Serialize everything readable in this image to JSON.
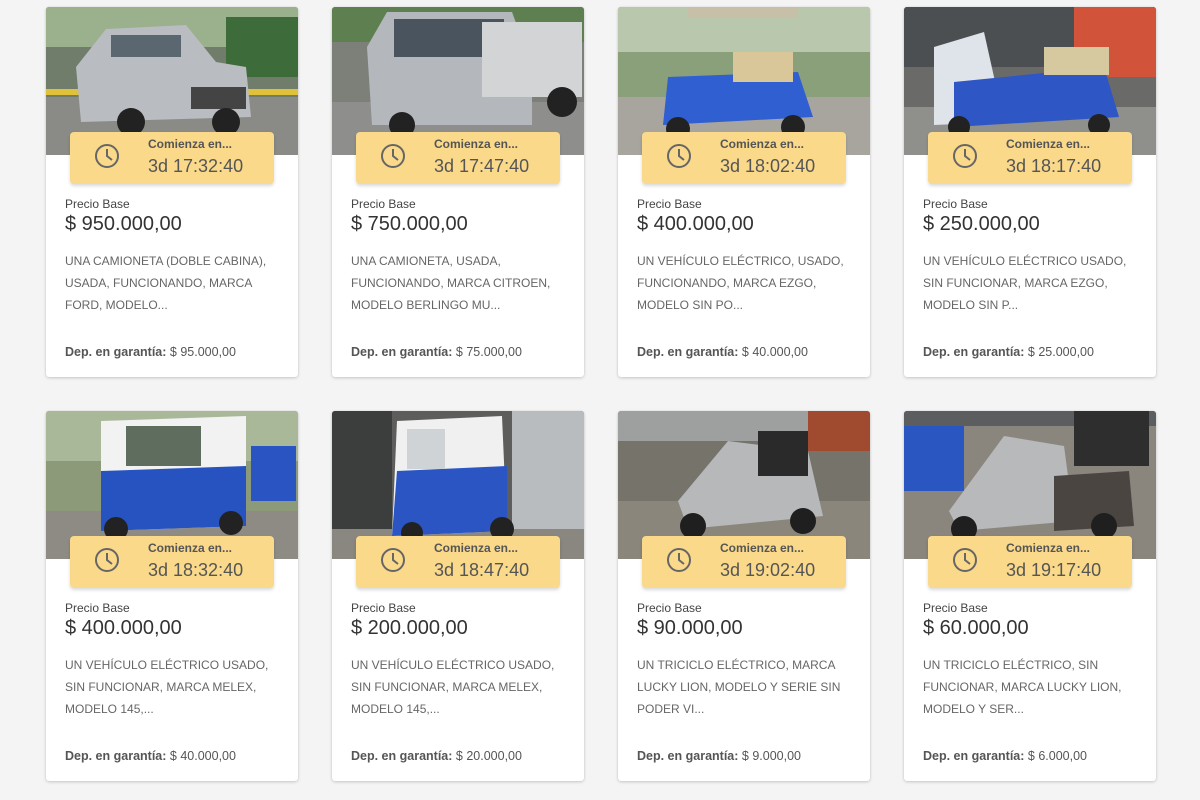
{
  "badge_label": "Comienza en...",
  "price_label": "Precio Base",
  "deposit_label": "Dep. en garantía:",
  "accent_color": "#fad98a",
  "lots": [
    {
      "photo": "silver-pickup-truck",
      "countdown": "3d 17:32:40",
      "price": "$ 950.000,00",
      "description": "UNA CAMIONETA (DOBLE CABINA), USADA, FUNCIONANDO, MARCA FORD, MODELO...",
      "deposit": "$ 95.000,00"
    },
    {
      "photo": "silver-van",
      "countdown": "3d 17:47:40",
      "price": "$ 750.000,00",
      "description": "UNA CAMIONETA, USADA, FUNCIONANDO, MARCA CITROEN, MODELO BERLINGO MU...",
      "deposit": "$ 75.000,00"
    },
    {
      "photo": "blue-golf-cart",
      "countdown": "3d 18:02:40",
      "price": "$ 400.000,00",
      "description": "UN VEHÍCULO ELÉCTRICO, USADO, FUNCIONANDO, MARCA EZGO, MODELO SIN PO...",
      "deposit": "$ 40.000,00"
    },
    {
      "photo": "blue-golf-cart-indoor",
      "countdown": "3d 18:17:40",
      "price": "$ 250.000,00",
      "description": "UN VEHÍCULO ELÉCTRICO USADO, SIN FUNCIONAR, MARCA EZGO, MODELO SIN P...",
      "deposit": "$ 25.000,00"
    },
    {
      "photo": "white-blue-utility-vehicle",
      "countdown": "3d 18:32:40",
      "price": "$ 400.000,00",
      "description": "UN VEHÍCULO ELÉCTRICO USADO, SIN FUNCIONAR, MARCA MELEX, MODELO 145,...",
      "deposit": "$ 40.000,00"
    },
    {
      "photo": "white-blue-utility-vehicle-shed",
      "countdown": "3d 18:47:40",
      "price": "$ 200.000,00",
      "description": "UN VEHÍCULO ELÉCTRICO USADO, SIN FUNCIONAR, MARCA MELEX, MODELO 145,...",
      "deposit": "$ 20.000,00"
    },
    {
      "photo": "silver-mobility-tricycle",
      "countdown": "3d 19:02:40",
      "price": "$ 90.000,00",
      "description": "UN TRICICLO ELÉCTRICO, MARCA LUCKY LION, MODELO Y SERIE SIN PODER VI...",
      "deposit": "$ 9.000,00"
    },
    {
      "photo": "silver-mobility-tricycle-yard",
      "countdown": "3d 19:17:40",
      "price": "$ 60.000,00",
      "description": "UN TRICICLO ELÉCTRICO, SIN FUNCIONAR, MARCA LUCKY LION, MODELO Y SER...",
      "deposit": "$ 6.000,00"
    }
  ]
}
